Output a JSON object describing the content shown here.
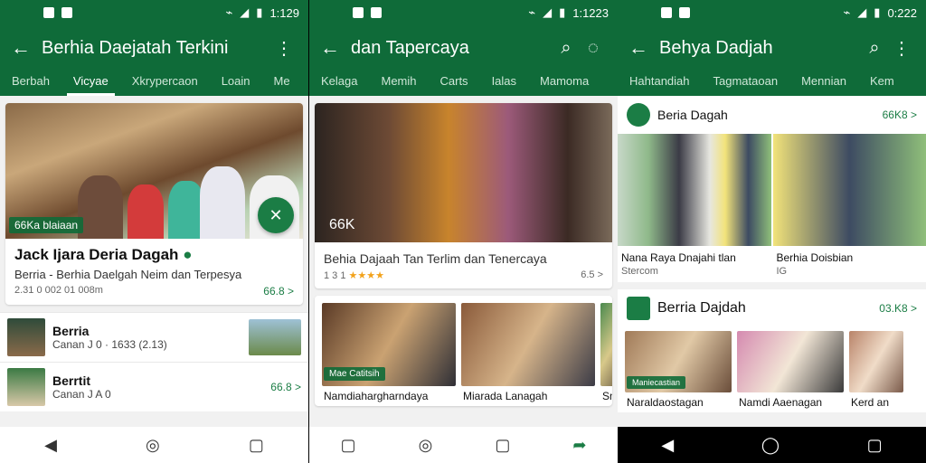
{
  "screen1": {
    "status": {
      "time": "1:129"
    },
    "title": "Berhia Daejatah Terkini",
    "tabs": [
      "Berbah",
      "Vicyae",
      "Xkrypercaon",
      "Loain",
      "Me"
    ],
    "active_tab": 1,
    "hero": {
      "badge": "66Ka blaiaan",
      "headline": "Jack Ijara Deria Dagah",
      "sub": "Berria - Berhia Daelgah Neim dan Terpesya",
      "date": "2.31 0 002 01 008m",
      "count": "66.8 >"
    },
    "rows": [
      {
        "title": "Berria",
        "meta": "Canan J 0 · 1633 (2.13)"
      },
      {
        "title": "Berrtit",
        "meta": "Canan J A 0",
        "count": "66.8 >"
      }
    ]
  },
  "screen2": {
    "status": {
      "time": "1:1223"
    },
    "title": "dan Tapercaya",
    "tabs": [
      "Kelaga",
      "Memih",
      "Carts",
      "Ialas",
      "Mamoma"
    ],
    "hero": {
      "badge": "66K",
      "headline": "Behia Dajaah Tan Terlim dan Tenercaya",
      "rating_num": "1 3 1",
      "stars": "★★★★",
      "count": "6.5 >"
    },
    "mini": [
      {
        "badge": "Mae Catitsih",
        "caption": "Namdiahargharndaya"
      },
      {
        "caption": "Miarada Lanagah"
      },
      {
        "caption": "Sm"
      }
    ]
  },
  "screen3": {
    "status": {
      "time": "0:222"
    },
    "title": "Behya Dadjah",
    "tabs": [
      "Hahtandiah",
      "Tagmataoan",
      "Mennian",
      "Kem"
    ],
    "section1": {
      "name": "Beria Dagah",
      "count": "66K8 >"
    },
    "pair": [
      {
        "caption": "Nana Raya Dnajahi tlan",
        "meta": "Stercom"
      },
      {
        "caption": "Berhia Doisbian",
        "meta": "IG"
      }
    ],
    "section2": {
      "name": "Berria Dajdah",
      "count": "03.K8 >"
    },
    "mini": [
      {
        "badge": "Maniecastian",
        "caption": "Naraldaostagan"
      },
      {
        "caption": "Namdi Aaenagan"
      },
      {
        "caption": "Kerd an"
      }
    ]
  }
}
